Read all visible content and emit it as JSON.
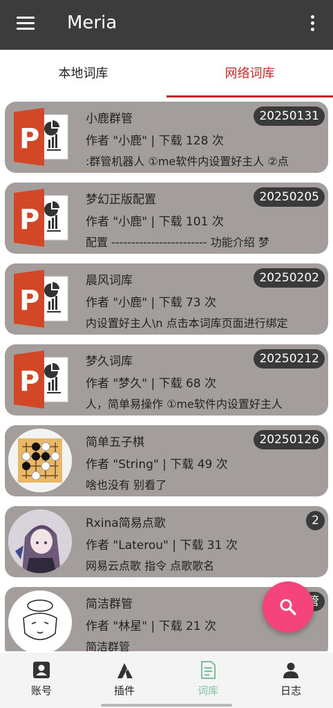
{
  "app": {
    "title": "Meria"
  },
  "icons": {
    "menu": "hamburger-menu-icon",
    "more": "more-vert-icon",
    "fab": "search-icon"
  },
  "tabs": [
    {
      "label": "本地词库"
    },
    {
      "label": "网络词库"
    }
  ],
  "colors": {
    "appbar": "#3c3c3c",
    "accent": "#c62828",
    "card": "#a39e9b",
    "fab": "#f5437c",
    "nav_active": "#7bbf9c"
  },
  "items": [
    {
      "name": "小鹿群管",
      "meta": "作者 \"小鹿\" | 下载 128 次",
      "desc": ":群管机器人 ①me软件内设置好主人 ②点",
      "badge": "20250131",
      "icon": "powerpoint-icon"
    },
    {
      "name": "梦幻正版配置",
      "meta": "作者 \"小鹿\" | 下载 101 次",
      "desc": "配置 ------------------------ 功能介绍 梦",
      "badge": "20250205",
      "icon": "powerpoint-icon"
    },
    {
      "name": "晨风词库",
      "meta": "作者 \"小鹿\" | 下载 73 次",
      "desc": "内设置好主人\\n 点击本词库页面进行绑定",
      "badge": "20250202",
      "icon": "powerpoint-icon"
    },
    {
      "name": "梦久词库",
      "meta": "作者 \"梦久\" | 下载 68 次",
      "desc": "人，简单易操作 ①me软件内设置好主人",
      "badge": "20250212",
      "icon": "powerpoint-icon"
    },
    {
      "name": "简单五子棋",
      "meta": "作者 \"String\" | 下载 49 次",
      "desc": "啥也没有 别看了",
      "badge": "20250126",
      "icon": "gomoku-board-avatar"
    },
    {
      "name": "Rxina简易点歌",
      "meta": "作者 \"Laterou\" | 下载 31 次",
      "desc": "网易云点歌  指令 点歌歌名",
      "badge": "2",
      "icon": "anime-girl-avatar"
    },
    {
      "name": "简洁群管",
      "meta": "作者 \"林星\" | 下载 21 次",
      "desc": "简洁群管",
      "badge": "管",
      "icon": "cartoon-face-avatar"
    }
  ],
  "bottom_nav": [
    {
      "label": "账号",
      "icon": "account-icon"
    },
    {
      "label": "插件",
      "icon": "plugin-icon"
    },
    {
      "label": "词库",
      "icon": "document-icon"
    },
    {
      "label": "日志",
      "icon": "person-icon"
    }
  ]
}
